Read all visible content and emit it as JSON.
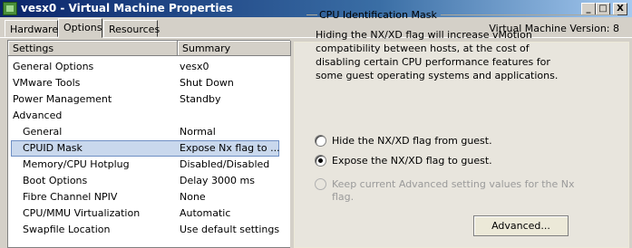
{
  "window": {
    "title": "vesx0 - Virtual Machine Properties",
    "min_label": "_",
    "max_label": "□",
    "close_label": "X"
  },
  "tabs": [
    {
      "label": "Hardware"
    },
    {
      "label": "Options"
    },
    {
      "label": "Resources"
    }
  ],
  "vm_version": "Virtual Machine Version: 8",
  "list": {
    "headers": {
      "settings": "Settings",
      "summary": "Summary"
    },
    "rows": [
      {
        "name": "General Options",
        "value": "vesx0"
      },
      {
        "name": "VMware Tools",
        "value": "Shut Down"
      },
      {
        "name": "Power Management",
        "value": "Standby"
      },
      {
        "name": "Advanced",
        "value": ""
      },
      {
        "name": "General",
        "value": "Normal"
      },
      {
        "name": "CPUID Mask",
        "value": "Expose Nx flag to ..."
      },
      {
        "name": "Memory/CPU Hotplug",
        "value": "Disabled/Disabled"
      },
      {
        "name": "Boot Options",
        "value": "Delay 3000 ms"
      },
      {
        "name": "Fibre Channel NPIV",
        "value": "None"
      },
      {
        "name": "CPU/MMU Virtualization",
        "value": "Automatic"
      },
      {
        "name": "Swapfile Location",
        "value": "Use default settings"
      }
    ]
  },
  "cpuid_group": {
    "legend": "CPU Identification Mask",
    "description": "Hiding the NX/XD flag will increase vMotion compatibility between hosts, at the cost of disabling certain CPU performance features for some guest operating systems and applications.",
    "options": [
      {
        "label": "Hide the NX/XD flag from guest.",
        "checked": false,
        "disabled": false
      },
      {
        "label": "Expose the NX/XD flag to guest.",
        "checked": true,
        "disabled": false
      },
      {
        "label": "Keep current Advanced setting values for the Nx flag.",
        "checked": false,
        "disabled": true
      }
    ],
    "advanced_button": "Advanced..."
  }
}
